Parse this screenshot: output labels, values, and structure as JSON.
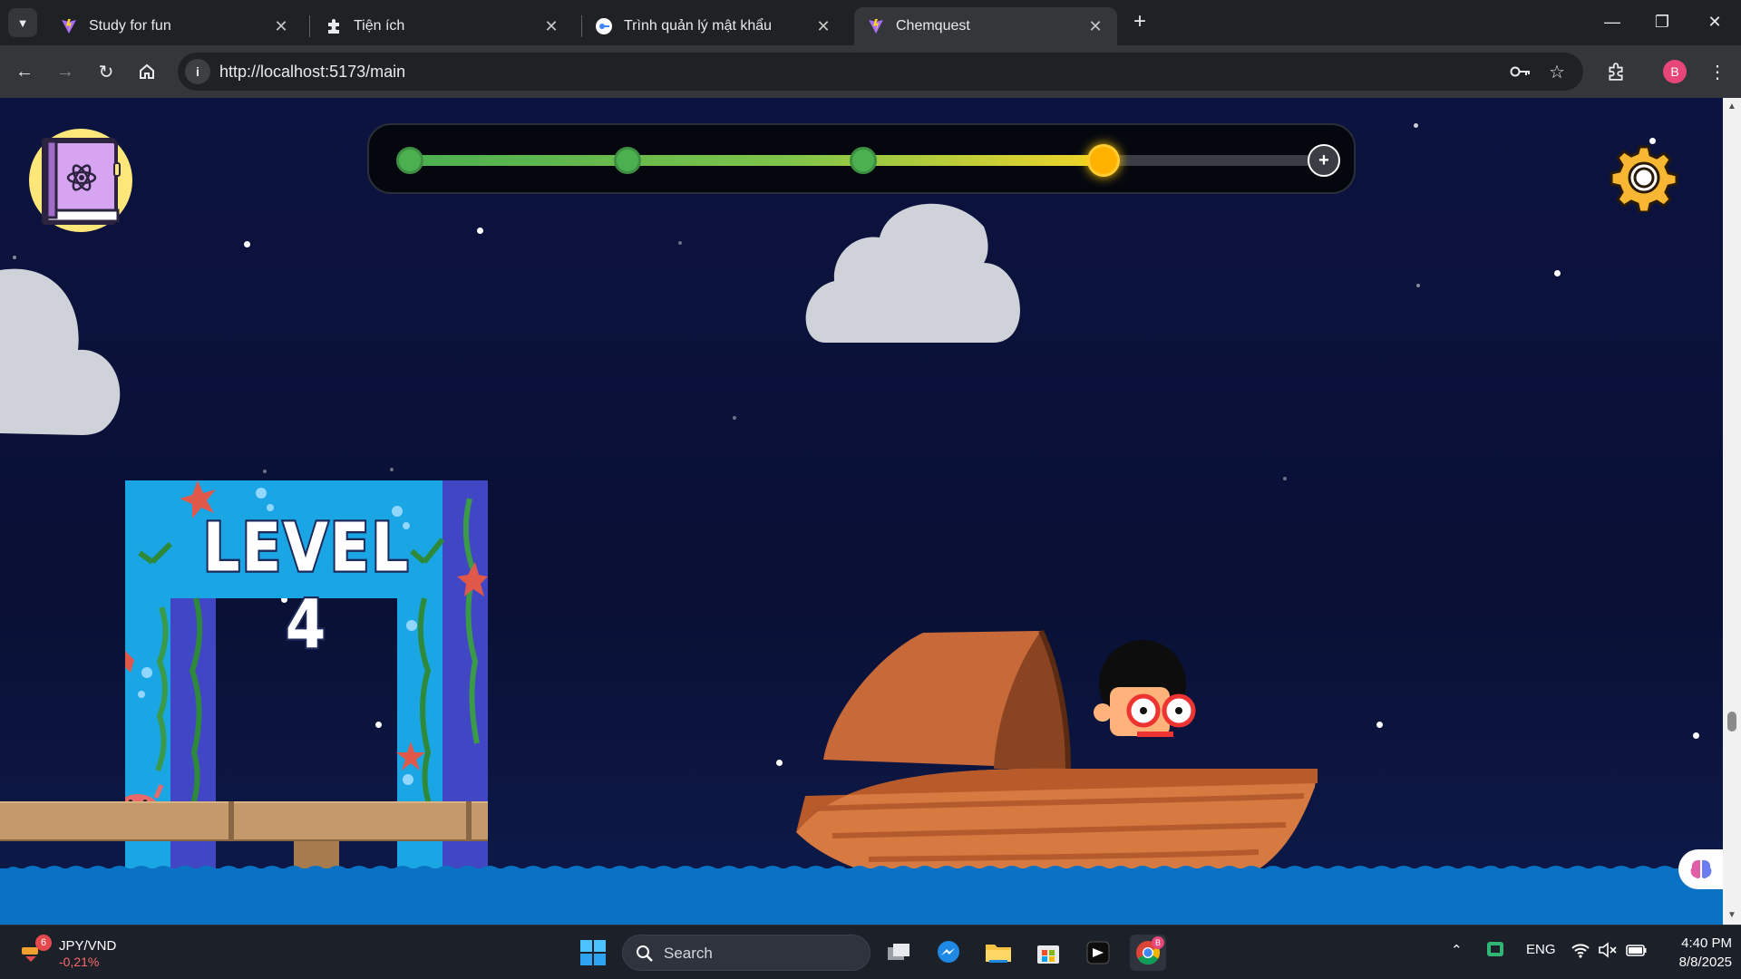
{
  "browser": {
    "tabs": [
      {
        "title": "Study for fun",
        "favicon": "vite-logo-icon",
        "active": false
      },
      {
        "title": "Tiện ích",
        "favicon": "puzzle-extension-icon",
        "active": false
      },
      {
        "title": "Trình quản lý mật khẩu",
        "favicon": "password-manager-icon",
        "active": false
      },
      {
        "title": "Chemquest",
        "favicon": "vite-logo-icon",
        "active": true
      }
    ],
    "url": "http://localhost:5173/main",
    "profile_initial": "B"
  },
  "game": {
    "progress": {
      "total_nodes": 5,
      "completed_nodes": 3,
      "current_node": 4
    },
    "level_sign": "LEVEL 4"
  },
  "taskbar": {
    "widget": {
      "badge": "6",
      "pair": "JPY/VND",
      "change": "-0,21%"
    },
    "search_label": "Search",
    "chrome_badge": "B",
    "language": "ENG",
    "time": "4:40 PM",
    "date": "8/8/2025"
  },
  "colors": {
    "sky": "#0b1230",
    "water": "#0a72c2",
    "progress_green": "#4caf50",
    "progress_current": "#ffb300",
    "boat": "#c8693a"
  }
}
